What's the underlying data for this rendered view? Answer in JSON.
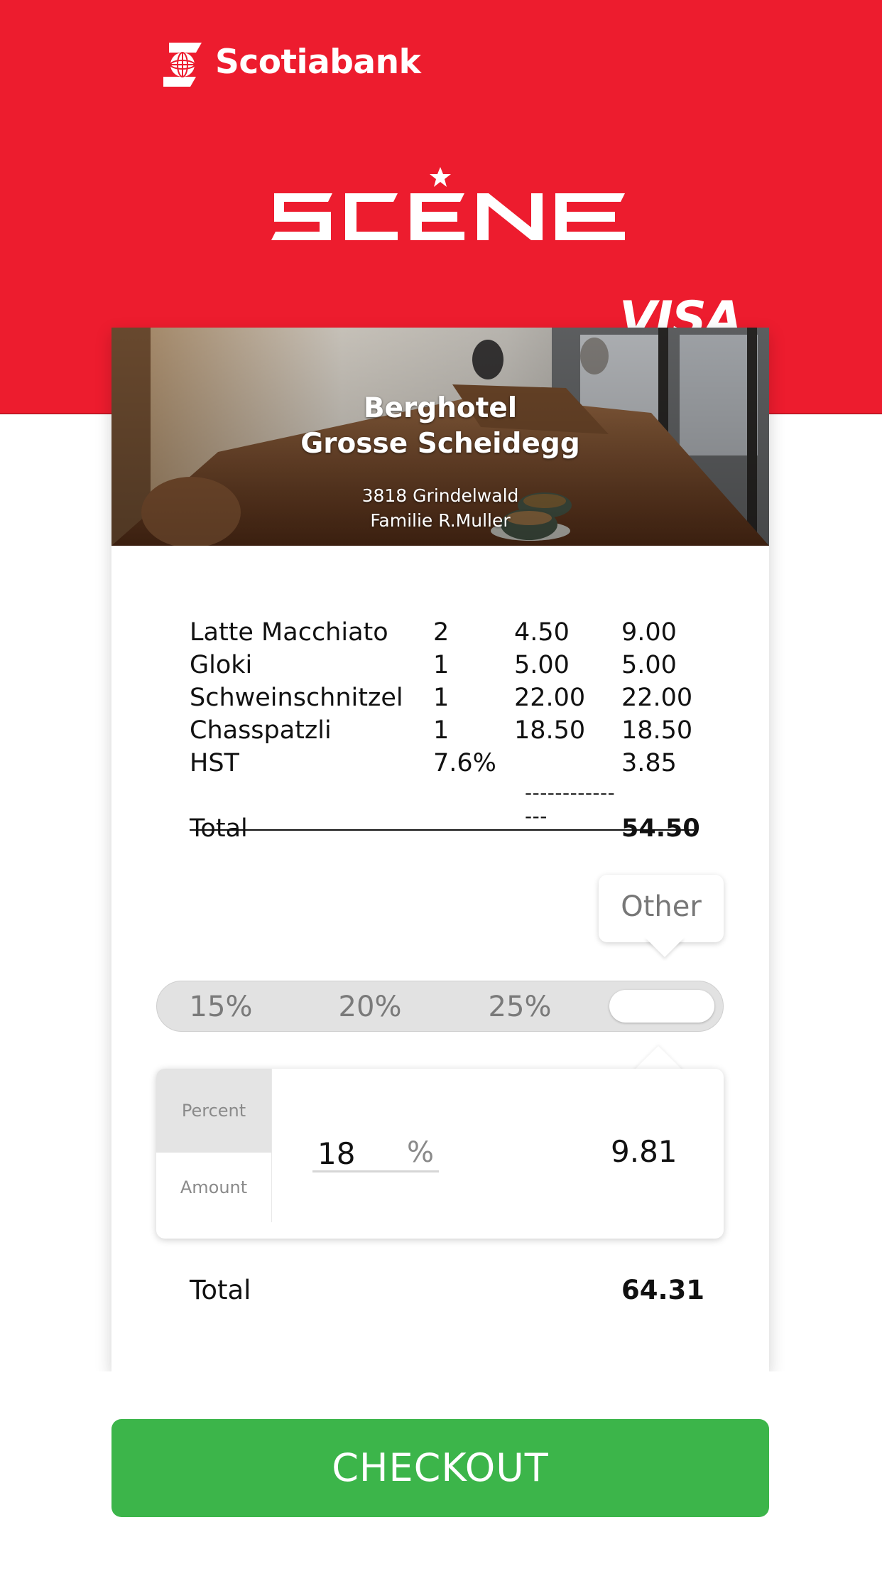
{
  "brand": {
    "bank_name": "Scotiabank",
    "program_name": "SCENE",
    "card_network": "VISA",
    "accent_color": "#ed1c2e",
    "logo_icon": "scotiabank-globe-icon",
    "star_icon": "star-icon"
  },
  "merchant": {
    "name_line1": "Berghotel",
    "name_line2": "Grosse Scheidegg",
    "address_line1": "3818 Grindelwald",
    "address_line2": "Familie R.Muller"
  },
  "receipt": {
    "items": [
      {
        "name": "Latte Macchiato",
        "qty": "2",
        "unit_price": "4.50",
        "total": "9.00"
      },
      {
        "name": "Gloki",
        "qty": "1",
        "unit_price": "5.00",
        "total": "5.00"
      },
      {
        "name": "Schweinschnitzel",
        "qty": "1",
        "unit_price": "22.00",
        "total": "22.00"
      },
      {
        "name": "Chasspatzli",
        "qty": "1",
        "unit_price": "18.50",
        "total": "18.50"
      },
      {
        "name": "HST",
        "qty": "7.6%",
        "unit_price": "",
        "total": "3.85"
      }
    ],
    "divider": "---------------",
    "subtotal_label": "Total",
    "subtotal_value": "54.50"
  },
  "tip": {
    "options": [
      "15%",
      "20%",
      "25%"
    ],
    "other_label": "Other",
    "selected": "Other",
    "tabs": {
      "percent": "Percent",
      "amount": "Amount"
    },
    "active_tab": "Percent",
    "percent_value": "18",
    "percent_symbol": "%",
    "tip_amount": "9.81"
  },
  "total": {
    "label": "Total",
    "value": "64.31"
  },
  "actions": {
    "checkout_label": "CHECKOUT",
    "checkout_color": "#3cb54a"
  }
}
